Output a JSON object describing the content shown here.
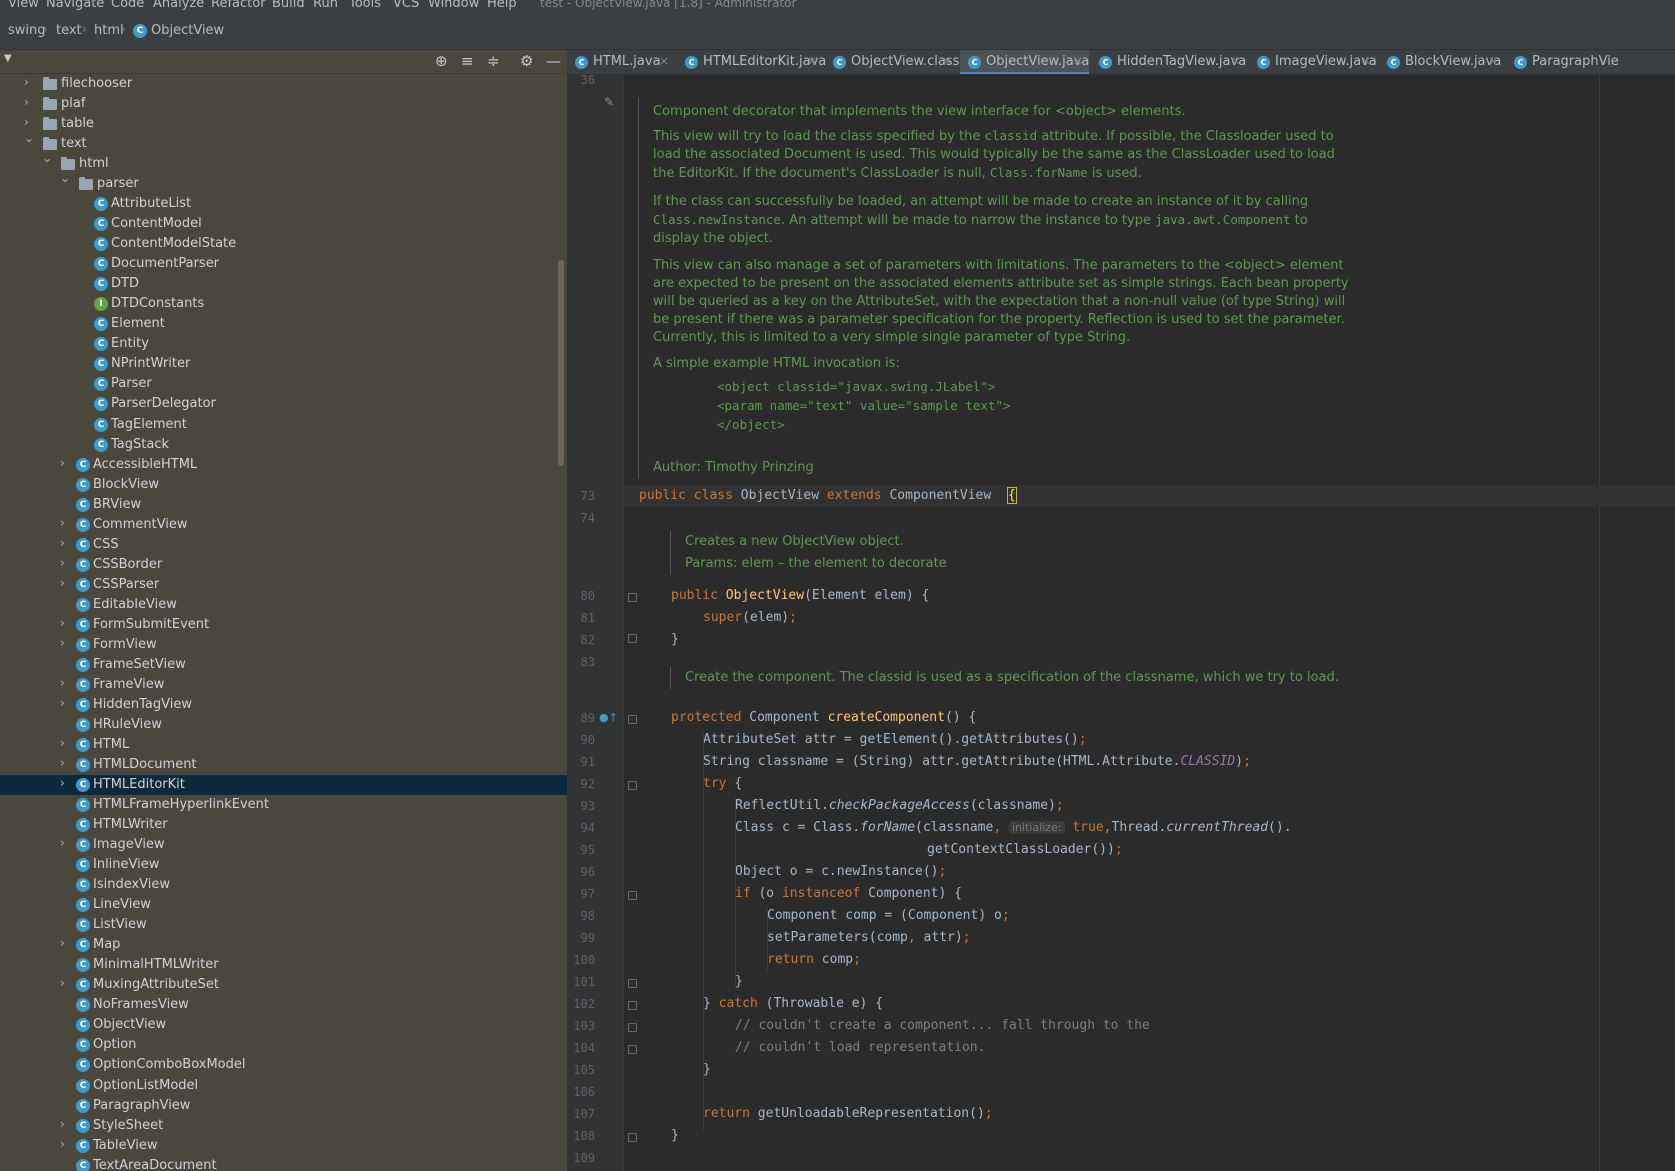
{
  "menubar": {
    "items": [
      "View",
      "Navigate",
      "Code",
      "Analyze",
      "Refactor",
      "Build",
      "Run",
      "Tools",
      "VCS",
      "Window",
      "Help"
    ],
    "window_title": "test - ObjectView.java [1.8] - Administrator"
  },
  "breadcrumb": {
    "items": [
      "swing",
      "text",
      "html",
      "ObjectView"
    ]
  },
  "project": {
    "tree": [
      {
        "label": "filechooser",
        "kind": "folder",
        "depth": 0,
        "arrow": "closed"
      },
      {
        "label": "plaf",
        "kind": "folder",
        "depth": 0,
        "arrow": "closed"
      },
      {
        "label": "table",
        "kind": "folder",
        "depth": 0,
        "arrow": "closed"
      },
      {
        "label": "text",
        "kind": "folder",
        "depth": 0,
        "arrow": "open"
      },
      {
        "label": "html",
        "kind": "folder",
        "depth": 1,
        "arrow": "open"
      },
      {
        "label": "parser",
        "kind": "folder",
        "depth": 2,
        "arrow": "open"
      },
      {
        "label": "AttributeList",
        "kind": "class",
        "depth": 3,
        "arrow": ""
      },
      {
        "label": "ContentModel",
        "kind": "class",
        "depth": 3,
        "arrow": ""
      },
      {
        "label": "ContentModelState",
        "kind": "class",
        "depth": 3,
        "arrow": ""
      },
      {
        "label": "DocumentParser",
        "kind": "class",
        "depth": 3,
        "arrow": ""
      },
      {
        "label": "DTD",
        "kind": "class",
        "depth": 3,
        "arrow": ""
      },
      {
        "label": "DTDConstants",
        "kind": "interface",
        "depth": 3,
        "arrow": ""
      },
      {
        "label": "Element",
        "kind": "class",
        "depth": 3,
        "arrow": ""
      },
      {
        "label": "Entity",
        "kind": "class",
        "depth": 3,
        "arrow": ""
      },
      {
        "label": "NPrintWriter",
        "kind": "class",
        "depth": 3,
        "arrow": ""
      },
      {
        "label": "Parser",
        "kind": "class",
        "depth": 3,
        "arrow": ""
      },
      {
        "label": "ParserDelegator",
        "kind": "class",
        "depth": 3,
        "arrow": ""
      },
      {
        "label": "TagElement",
        "kind": "class",
        "depth": 3,
        "arrow": ""
      },
      {
        "label": "TagStack",
        "kind": "class",
        "depth": 3,
        "arrow": ""
      },
      {
        "label": "AccessibleHTML",
        "kind": "class",
        "depth": 2,
        "arrow": "closed"
      },
      {
        "label": "BlockView",
        "kind": "class",
        "depth": 2,
        "arrow": ""
      },
      {
        "label": "BRView",
        "kind": "class",
        "depth": 2,
        "arrow": ""
      },
      {
        "label": "CommentView",
        "kind": "class",
        "depth": 2,
        "arrow": "closed"
      },
      {
        "label": "CSS",
        "kind": "class",
        "depth": 2,
        "arrow": "closed"
      },
      {
        "label": "CSSBorder",
        "kind": "class",
        "depth": 2,
        "arrow": "closed"
      },
      {
        "label": "CSSParser",
        "kind": "class",
        "depth": 2,
        "arrow": "closed"
      },
      {
        "label": "EditableView",
        "kind": "class",
        "depth": 2,
        "arrow": ""
      },
      {
        "label": "FormSubmitEvent",
        "kind": "class",
        "depth": 2,
        "arrow": "closed"
      },
      {
        "label": "FormView",
        "kind": "class",
        "depth": 2,
        "arrow": "closed"
      },
      {
        "label": "FrameSetView",
        "kind": "class",
        "depth": 2,
        "arrow": ""
      },
      {
        "label": "FrameView",
        "kind": "class",
        "depth": 2,
        "arrow": "closed"
      },
      {
        "label": "HiddenTagView",
        "kind": "class",
        "depth": 2,
        "arrow": "closed"
      },
      {
        "label": "HRuleView",
        "kind": "class",
        "depth": 2,
        "arrow": ""
      },
      {
        "label": "HTML",
        "kind": "class",
        "depth": 2,
        "arrow": "closed"
      },
      {
        "label": "HTMLDocument",
        "kind": "class",
        "depth": 2,
        "arrow": "closed"
      },
      {
        "label": "HTMLEditorKit",
        "kind": "class",
        "depth": 2,
        "arrow": "closed",
        "selected": true
      },
      {
        "label": "HTMLFrameHyperlinkEvent",
        "kind": "class",
        "depth": 2,
        "arrow": ""
      },
      {
        "label": "HTMLWriter",
        "kind": "class",
        "depth": 2,
        "arrow": ""
      },
      {
        "label": "ImageView",
        "kind": "class",
        "depth": 2,
        "arrow": "closed"
      },
      {
        "label": "InlineView",
        "kind": "class",
        "depth": 2,
        "arrow": ""
      },
      {
        "label": "IsindexView",
        "kind": "class",
        "depth": 2,
        "arrow": ""
      },
      {
        "label": "LineView",
        "kind": "class",
        "depth": 2,
        "arrow": ""
      },
      {
        "label": "ListView",
        "kind": "class",
        "depth": 2,
        "arrow": ""
      },
      {
        "label": "Map",
        "kind": "class",
        "depth": 2,
        "arrow": "closed"
      },
      {
        "label": "MinimalHTMLWriter",
        "kind": "class",
        "depth": 2,
        "arrow": ""
      },
      {
        "label": "MuxingAttributeSet",
        "kind": "class",
        "depth": 2,
        "arrow": "closed"
      },
      {
        "label": "NoFramesView",
        "kind": "class",
        "depth": 2,
        "arrow": ""
      },
      {
        "label": "ObjectView",
        "kind": "class",
        "depth": 2,
        "arrow": ""
      },
      {
        "label": "Option",
        "kind": "class",
        "depth": 2,
        "arrow": ""
      },
      {
        "label": "OptionComboBoxModel",
        "kind": "class",
        "depth": 2,
        "arrow": ""
      },
      {
        "label": "OptionListModel",
        "kind": "class",
        "depth": 2,
        "arrow": ""
      },
      {
        "label": "ParagraphView",
        "kind": "class",
        "depth": 2,
        "arrow": ""
      },
      {
        "label": "StyleSheet",
        "kind": "class",
        "depth": 2,
        "arrow": "closed"
      },
      {
        "label": "TableView",
        "kind": "class",
        "depth": 2,
        "arrow": "closed"
      },
      {
        "label": "TextAreaDocument",
        "kind": "class",
        "depth": 2,
        "arrow": ""
      }
    ]
  },
  "tabs": [
    {
      "label": "HTML.java",
      "active": false
    },
    {
      "label": "HTMLEditorKit.java",
      "active": false
    },
    {
      "label": "ObjectView.class",
      "active": false
    },
    {
      "label": "ObjectView.java",
      "active": true
    },
    {
      "label": "HiddenTagView.java",
      "active": false
    },
    {
      "label": "ImageView.java",
      "active": false
    },
    {
      "label": "BlockView.java",
      "active": false
    },
    {
      "label": "ParagraphVie",
      "active": false
    }
  ],
  "editor": {
    "doc": {
      "p1": "Component decorator that implements the view interface for <object> elements.",
      "p2a": "This view will try to load the class specified by the ",
      "p2b": "classid",
      "p2c": " attribute. If possible, the Classloader used to",
      "p2d": "load the associated Document is used. This would typically be the same as the ClassLoader used to load",
      "p2e": "the EditorKit. If the document's ClassLoader is null, ",
      "p2f": "Class.forName",
      "p2g": " is used.",
      "p3a": "If the class can successfully be loaded, an attempt will be made to create an instance of it by calling",
      "p3b": "Class.newInstance",
      "p3c": ". An attempt will be made to narrow the instance to type ",
      "p3d": "java.awt.Component",
      "p3e": " to",
      "p3f": "display the object.",
      "p4a": "This view can also manage a set of parameters with limitations. The parameters to the <object> element",
      "p4b": "are expected to be present on the associated elements attribute set as simple strings. Each bean property",
      "p4c": "will be queried as a key on the AttributeSet, with the expectation that a non-null value (of type String) will",
      "p4d": "be present if there was a parameter specification for the property. Reflection is used to set the parameter.",
      "p4e": "Currently, this is limited to a very simple single parameter of type String.",
      "p5": "A simple example HTML invocation is:",
      "ex1": "<object classid=\"javax.swing.JLabel\">",
      "ex2": "<param name=\"text\" value=\"sample text\">",
      "ex3": "</object>",
      "author": "Author: Timothy Prinzing",
      "ctor1": "Creates a new ObjectView object.",
      "ctor2": "Params: elem – the element to decorate",
      "create": "Create the component. The classid is used as a specification of the classname, which we try to load."
    },
    "line_numbers": [
      "36",
      "73",
      "74",
      "80",
      "81",
      "82",
      "83",
      "89",
      "90",
      "91",
      "92",
      "93",
      "94",
      "95",
      "96",
      "97",
      "98",
      "99",
      "100",
      "101",
      "102",
      "103",
      "104",
      "105",
      "106",
      "107",
      "108",
      "109"
    ],
    "code": {
      "l73a": "public class ",
      "l73b": "ObjectView ",
      "l73c": "extends ",
      "l73d": "ComponentView  ",
      "l73e": "{",
      "l80a": "public ",
      "l80b": "ObjectView",
      "l80c": "(Element elem) {",
      "l81a": "super",
      "l81b": "(elem)",
      "l81c": ";",
      "l82": "}",
      "l89a": "protected ",
      "l89b": "Component ",
      "l89c": "createComponent",
      "l89d": "() {",
      "l90a": "AttributeSet attr = getElement().getAttributes()",
      "l90b": ";",
      "l91a": "String classname = (String) attr.getAttribute(HTML.Attribute.",
      "l91b": "CLASSID",
      "l91c": ")",
      "l91d": ";",
      "l92a": "try ",
      "l92b": "{",
      "l93a": "ReflectUtil.",
      "l93b": "checkPackageAccess",
      "l93c": "(classname)",
      "l93d": ";",
      "l94a": "Class c = Class.",
      "l94b": "forName",
      "l94c": "(classname",
      "l94d": ", ",
      "l94hint": "initialize:",
      "l94e": " true",
      "l94f": ",",
      "l94g": "Thread.",
      "l94h": "currentThread",
      "l94i": "().",
      "l95a": "getContextClassLoader())",
      "l95b": ";",
      "l96a": "Object o = c.newInstance()",
      "l96b": ";",
      "l97a": "if ",
      "l97b": "(o ",
      "l97c": "instanceof ",
      "l97d": "Component) {",
      "l98a": "Component comp = (Component) o",
      "l98b": ";",
      "l99a": "setParameters(comp",
      "l99b": ", ",
      "l99c": "attr)",
      "l99d": ";",
      "l100a": "return ",
      "l100b": "comp",
      "l100c": ";",
      "l101": "}",
      "l102a": "} ",
      "l102b": "catch ",
      "l102c": "(Throwable e) {",
      "l103": "// couldn't create a component... fall through to the",
      "l104": "// couldn't load representation.",
      "l105": "}",
      "l107a": "return ",
      "l107b": "getUnloadableRepresentation()",
      "l107c": ";",
      "l108": "}"
    }
  },
  "colors": {
    "keyword": "#cc7832",
    "method": "#ffc66d",
    "doc": "#629755",
    "constant": "#9876aa",
    "comment": "#808080",
    "selection": "#0d293e",
    "accent": "#4a88c7"
  }
}
